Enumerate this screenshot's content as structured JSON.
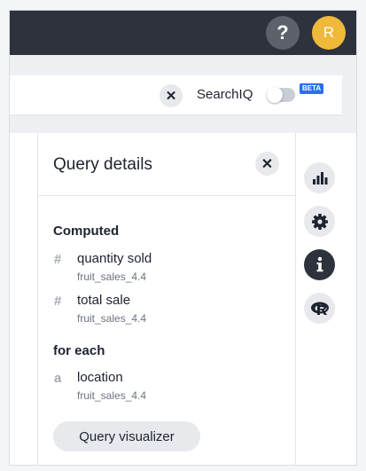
{
  "header": {
    "help_label": "?",
    "avatar_initial": "R"
  },
  "search": {
    "clear_label": "✕",
    "searchiq_label": "SearchIQ",
    "beta_badge": "BETA",
    "searchiq_enabled": false
  },
  "query_details": {
    "title": "Query details",
    "close_label": "✕",
    "computed_heading": "Computed",
    "computed_columns": [
      {
        "type_icon": "#",
        "name": "quantity sold",
        "source": "fruit_sales_4.4"
      },
      {
        "type_icon": "#",
        "name": "total sale",
        "source": "fruit_sales_4.4"
      }
    ],
    "for_each_heading": "for each",
    "for_each_columns": [
      {
        "type_icon": "a",
        "name": "location",
        "source": "fruit_sales_4.4"
      }
    ],
    "visualizer_button": "Query visualizer"
  },
  "right_rail": {
    "items": [
      {
        "icon": "bar-chart-icon",
        "active": false
      },
      {
        "icon": "gear-icon",
        "active": false
      },
      {
        "icon": "info-icon",
        "active": true
      },
      {
        "icon": "r-logo-icon",
        "active": false
      }
    ]
  },
  "colors": {
    "topbar": "#2e323c",
    "avatar": "#f0b93a",
    "beta": "#2770ef",
    "active_rail": "#2e323c"
  }
}
